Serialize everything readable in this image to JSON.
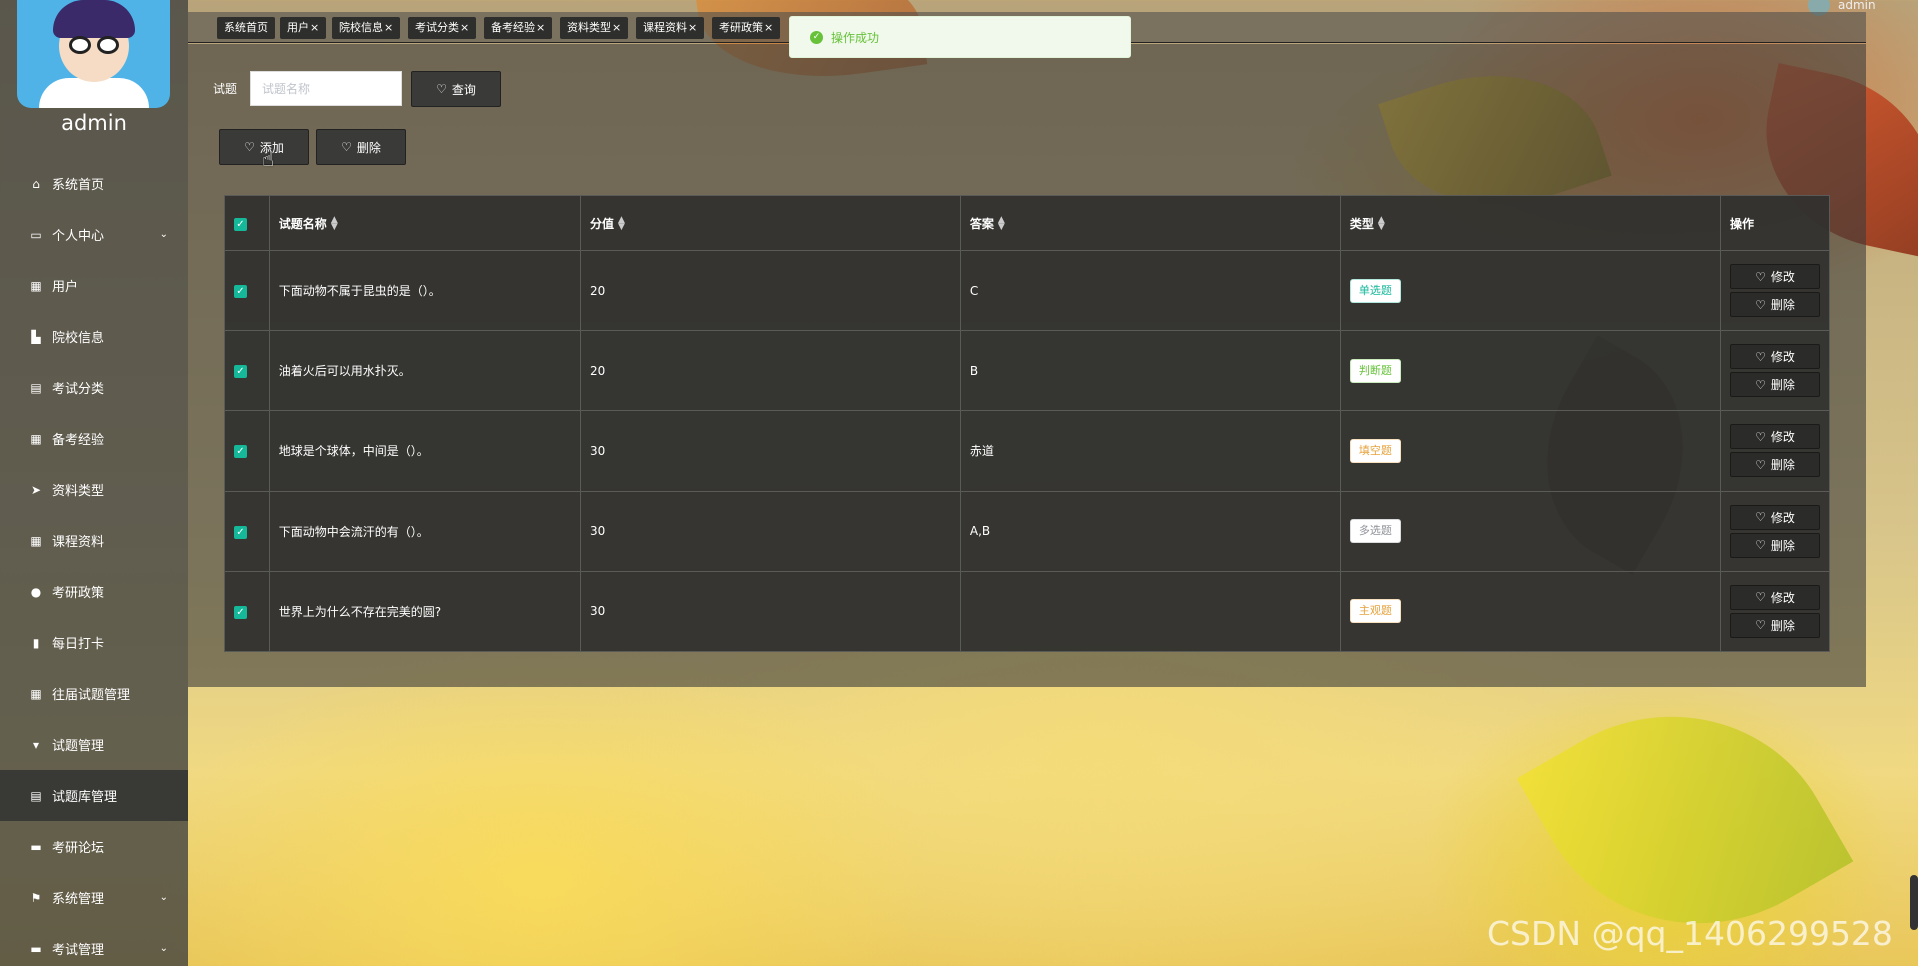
{
  "user": {
    "name": "admin",
    "top_name": "admin"
  },
  "tags": [
    {
      "label": "系统首页",
      "close": ""
    },
    {
      "label": "用户",
      "close": "×"
    },
    {
      "label": "院校信息",
      "close": "×"
    },
    {
      "label": "考试分类",
      "close": "×"
    },
    {
      "label": "备考经验",
      "close": "×"
    },
    {
      "label": "资料类型",
      "close": "×"
    },
    {
      "label": "课程资料",
      "close": "×"
    },
    {
      "label": "考研政策",
      "close": "×"
    }
  ],
  "menu": [
    {
      "label": "系统首页",
      "icon": "⌂"
    },
    {
      "label": "个人中心",
      "icon": "▭",
      "chev": "⌄"
    },
    {
      "label": "用户",
      "icon": "▦"
    },
    {
      "label": "院校信息",
      "icon": "▙"
    },
    {
      "label": "考试分类",
      "icon": "▤"
    },
    {
      "label": "备考经验",
      "icon": "▦"
    },
    {
      "label": "资料类型",
      "icon": "➤"
    },
    {
      "label": "课程资料",
      "icon": "▦"
    },
    {
      "label": "考研政策",
      "icon": "●"
    },
    {
      "label": "每日打卡",
      "icon": "▮"
    },
    {
      "label": "往届试题管理",
      "icon": "▦"
    },
    {
      "label": "试题管理",
      "icon": "▾"
    },
    {
      "label": "试题库管理",
      "icon": "▤",
      "active": true
    },
    {
      "label": "考研论坛",
      "icon": "▬"
    },
    {
      "label": "系统管理",
      "icon": "⚑",
      "chev": "⌄"
    },
    {
      "label": "考试管理",
      "icon": "▬",
      "chev": "⌄"
    }
  ],
  "search": {
    "label": "试题",
    "placeholder": "试题名称",
    "query_label": "查询"
  },
  "actions": {
    "add_label": "添加",
    "delete_label": "删除"
  },
  "toast": {
    "message": "操作成功"
  },
  "table": {
    "headers": {
      "name": "试题名称",
      "score": "分值",
      "answer": "答案",
      "type": "类型",
      "ops": "操作"
    },
    "edit_label": "修改",
    "delete_label": "删除",
    "rows": [
      {
        "name": "下面动物不属于昆虫的是（）。",
        "score": "20",
        "answer": "C",
        "type": "单选题",
        "type_color": "#16b89a"
      },
      {
        "name": "油着火后可以用水扑灭。",
        "score": "20",
        "answer": "B",
        "type": "判断题",
        "type_color": "#67c23a"
      },
      {
        "name": "地球是个球体，中间是（）。",
        "score": "30",
        "answer": "赤道",
        "type": "填空题",
        "type_color": "#e6a23c"
      },
      {
        "name": "下面动物中会流汗的有（）。",
        "score": "30",
        "answer": "A,B",
        "type": "多选题",
        "type_color": "#909399"
      },
      {
        "name": "世界上为什么不存在完美的圆?",
        "score": "30",
        "answer": "",
        "type": "主观题",
        "type_color": "#e6a23c"
      }
    ]
  },
  "watermark": "CSDN @qq_1406299528"
}
